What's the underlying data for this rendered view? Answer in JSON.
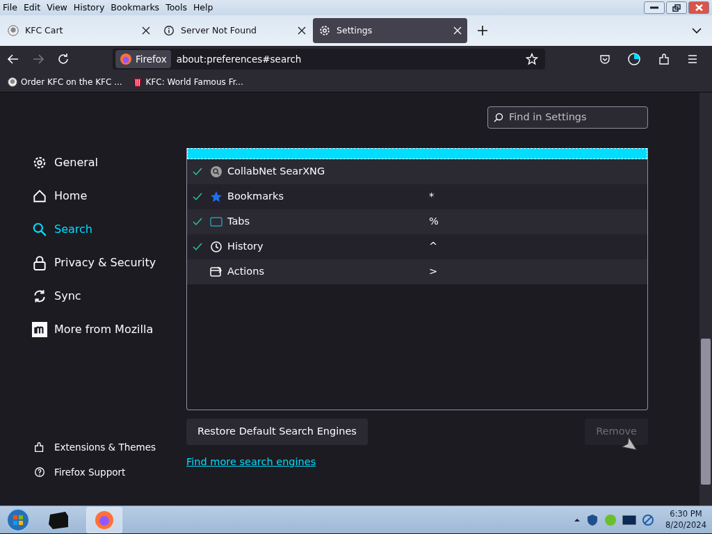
{
  "menu_bar": [
    "File",
    "Edit",
    "View",
    "History",
    "Bookmarks",
    "Tools",
    "Help"
  ],
  "tabs": [
    {
      "title": "KFC Cart",
      "selected": false
    },
    {
      "title": "Server Not Found",
      "selected": false
    },
    {
      "title": "Settings",
      "selected": true
    }
  ],
  "url_bar": {
    "identity": "Firefox",
    "url": "about:preferences#search"
  },
  "bookmarks": [
    {
      "title": "Order KFC on the KFC ..."
    },
    {
      "title": "KFC: World Famous Fr..."
    }
  ],
  "search_settings": {
    "placeholder": "Find in Settings"
  },
  "sidebar": {
    "items": [
      {
        "label": "General",
        "selected": false
      },
      {
        "label": "Home",
        "selected": false
      },
      {
        "label": "Search",
        "selected": true
      },
      {
        "label": "Privacy & Security",
        "selected": false
      },
      {
        "label": "Sync",
        "selected": false
      },
      {
        "label": "More from Mozilla",
        "selected": false
      }
    ],
    "footer": [
      {
        "label": "Extensions & Themes"
      },
      {
        "label": "Firefox Support"
      }
    ]
  },
  "engines": [
    {
      "selected": true
    },
    {
      "name": "CollabNet SearXNG",
      "checked": true,
      "selected": false
    },
    {
      "name": "Bookmarks",
      "keyword": "*",
      "checked": true,
      "selected": false
    },
    {
      "name": "Tabs",
      "keyword": "%",
      "checked": true,
      "selected": false
    },
    {
      "name": "History",
      "keyword": "^",
      "checked": true,
      "selected": false
    },
    {
      "name": "Actions",
      "keyword": ">",
      "checked": false,
      "selected": false
    }
  ],
  "buttons": [
    {
      "label": "Restore Default Search Engines",
      "disabled": false
    },
    {
      "label": "Remove",
      "disabled": true
    }
  ],
  "link": "Find more search engines",
  "taskbar": {
    "time": "6:30 PM",
    "date": "8/20/2024"
  }
}
